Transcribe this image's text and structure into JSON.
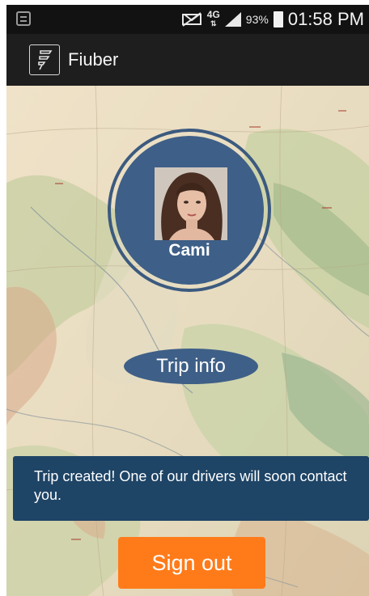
{
  "status_bar": {
    "network_type": "4G",
    "battery_percent": "93%",
    "time": "01:58 PM",
    "icons": [
      "notification-icon",
      "mute-icon",
      "signal-icon",
      "battery-icon"
    ]
  },
  "app_bar": {
    "title": "Fiuber",
    "logo_icon": "fiuber-logo-icon"
  },
  "profile": {
    "name": "Cami",
    "avatar_icon": "user-avatar"
  },
  "trip_info_label": "Trip info",
  "toast": {
    "message": "Trip created! One of our drivers will soon contact you."
  },
  "signout_label": "Sign out",
  "colors": {
    "status_bar_bg": "#121212",
    "app_bar_bg": "#1e1e1e",
    "profile_blue": "#3e5f87",
    "toast_bg": "#1e4466",
    "signout_orange": "#ff7b1a"
  }
}
